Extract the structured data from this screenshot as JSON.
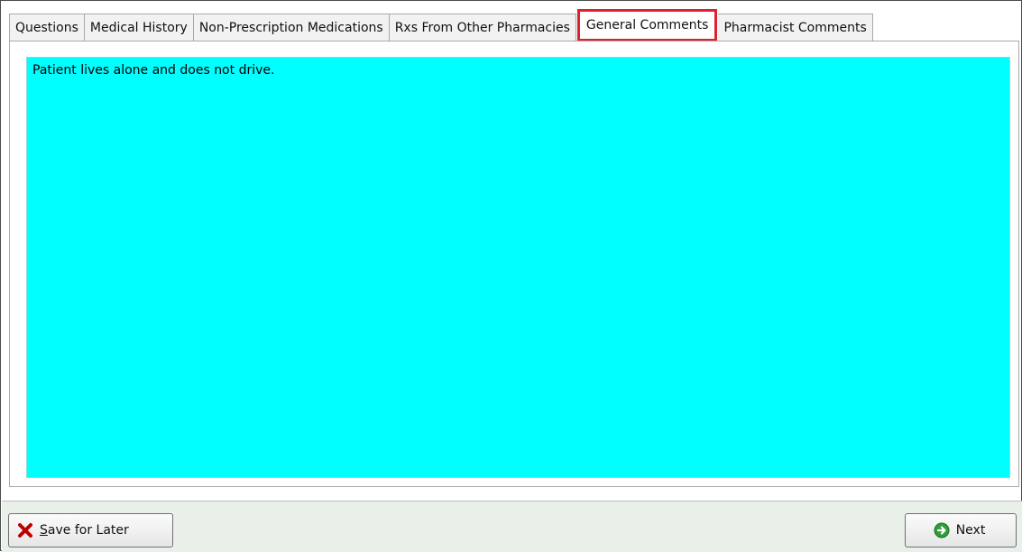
{
  "tabs": [
    {
      "label": "Questions",
      "active": false
    },
    {
      "label": "Medical History",
      "active": false
    },
    {
      "label": "Non-Prescription Medications",
      "active": false
    },
    {
      "label": "Rxs From Other Pharmacies",
      "active": false
    },
    {
      "label": "General Comments",
      "active": true
    },
    {
      "label": "Pharmacist Comments",
      "active": false
    }
  ],
  "general_comments": {
    "value": "Patient lives alone and does not drive."
  },
  "footer": {
    "save_label": "Save for Later",
    "next_label": "Next"
  },
  "icons": {
    "save": "x-icon",
    "next": "arrow-right-circle-icon"
  },
  "colors": {
    "comments_background": "#00ffff",
    "active_tab_highlight": "#e0202a",
    "save_icon": "#c00000",
    "next_icon": "#2e9e3a"
  }
}
